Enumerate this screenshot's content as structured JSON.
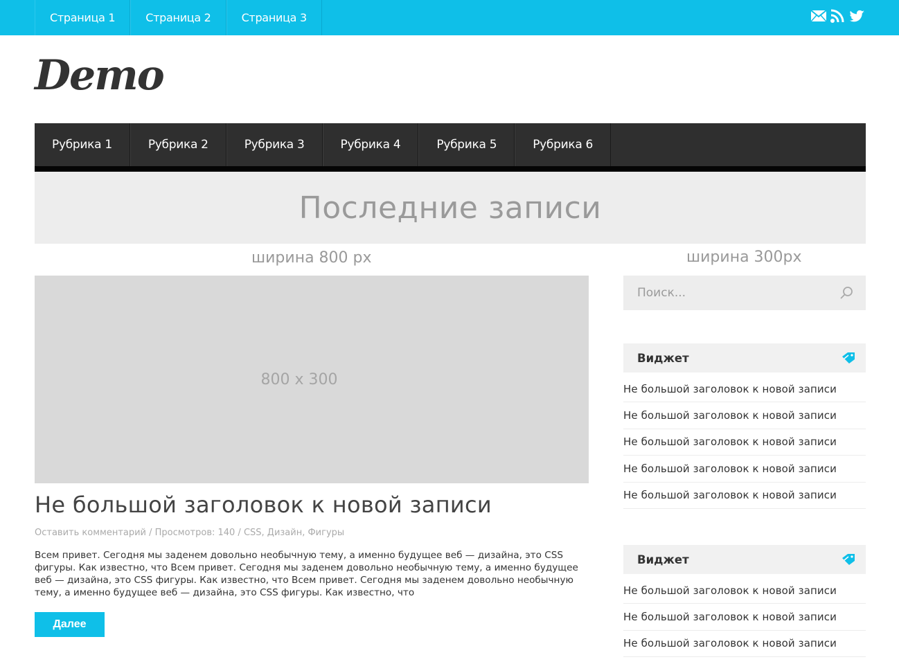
{
  "topbar": {
    "pages": [
      "Страница 1",
      "Страница 2",
      "Страница 3"
    ],
    "social_icons": [
      "mail-icon",
      "rss-icon",
      "twitter-icon"
    ],
    "color": "#0fbfe8"
  },
  "logo": {
    "text": "Demo"
  },
  "mainnav": {
    "items": [
      "Рубрика 1",
      "Рубрика 2",
      "Рубрика 3",
      "Рубрика 4",
      "Рубрика 5",
      "Рубрика 6"
    ]
  },
  "banner": {
    "title": "Последние записи"
  },
  "labels": {
    "content_width": "ширина 800 px",
    "sidebar_width": "ширина 300px"
  },
  "post": {
    "image_placeholder": "800 x 300",
    "title": "Не большой заголовок к новой записи",
    "meta": "Оставить комментарий / Просмотров: 140 / CSS, Дизайн, Фигуры",
    "excerpt": "Всем привет. Сегодня мы заденем довольно необычную тему, а именно будущее веб — дизайна, это CSS фигуры. Как известно, что Всем привет. Сегодня мы заденем довольно необычную тему, а именно будущее веб — дизайна, это CSS фигуры. Как известно, что Всем привет. Сегодня мы заденем довольно необычную тему, а именно будущее веб — дизайна, это CSS фигуры. Как известно, что",
    "more_label": "Далее"
  },
  "sidebar": {
    "search_placeholder": "Поиск...",
    "widgets": [
      {
        "title": "Виджет",
        "items": [
          "Не большой заголовок к новой записи",
          "Не большой заголовок к новой записи",
          "Не большой заголовок к новой записи",
          "Не большой заголовок к новой записи",
          "Не большой заголовок к новой записи"
        ]
      },
      {
        "title": "Виджет",
        "items": [
          "Не большой заголовок к новой записи",
          "Не большой заголовок к новой записи",
          "Не большой заголовок к новой записи"
        ]
      }
    ]
  }
}
